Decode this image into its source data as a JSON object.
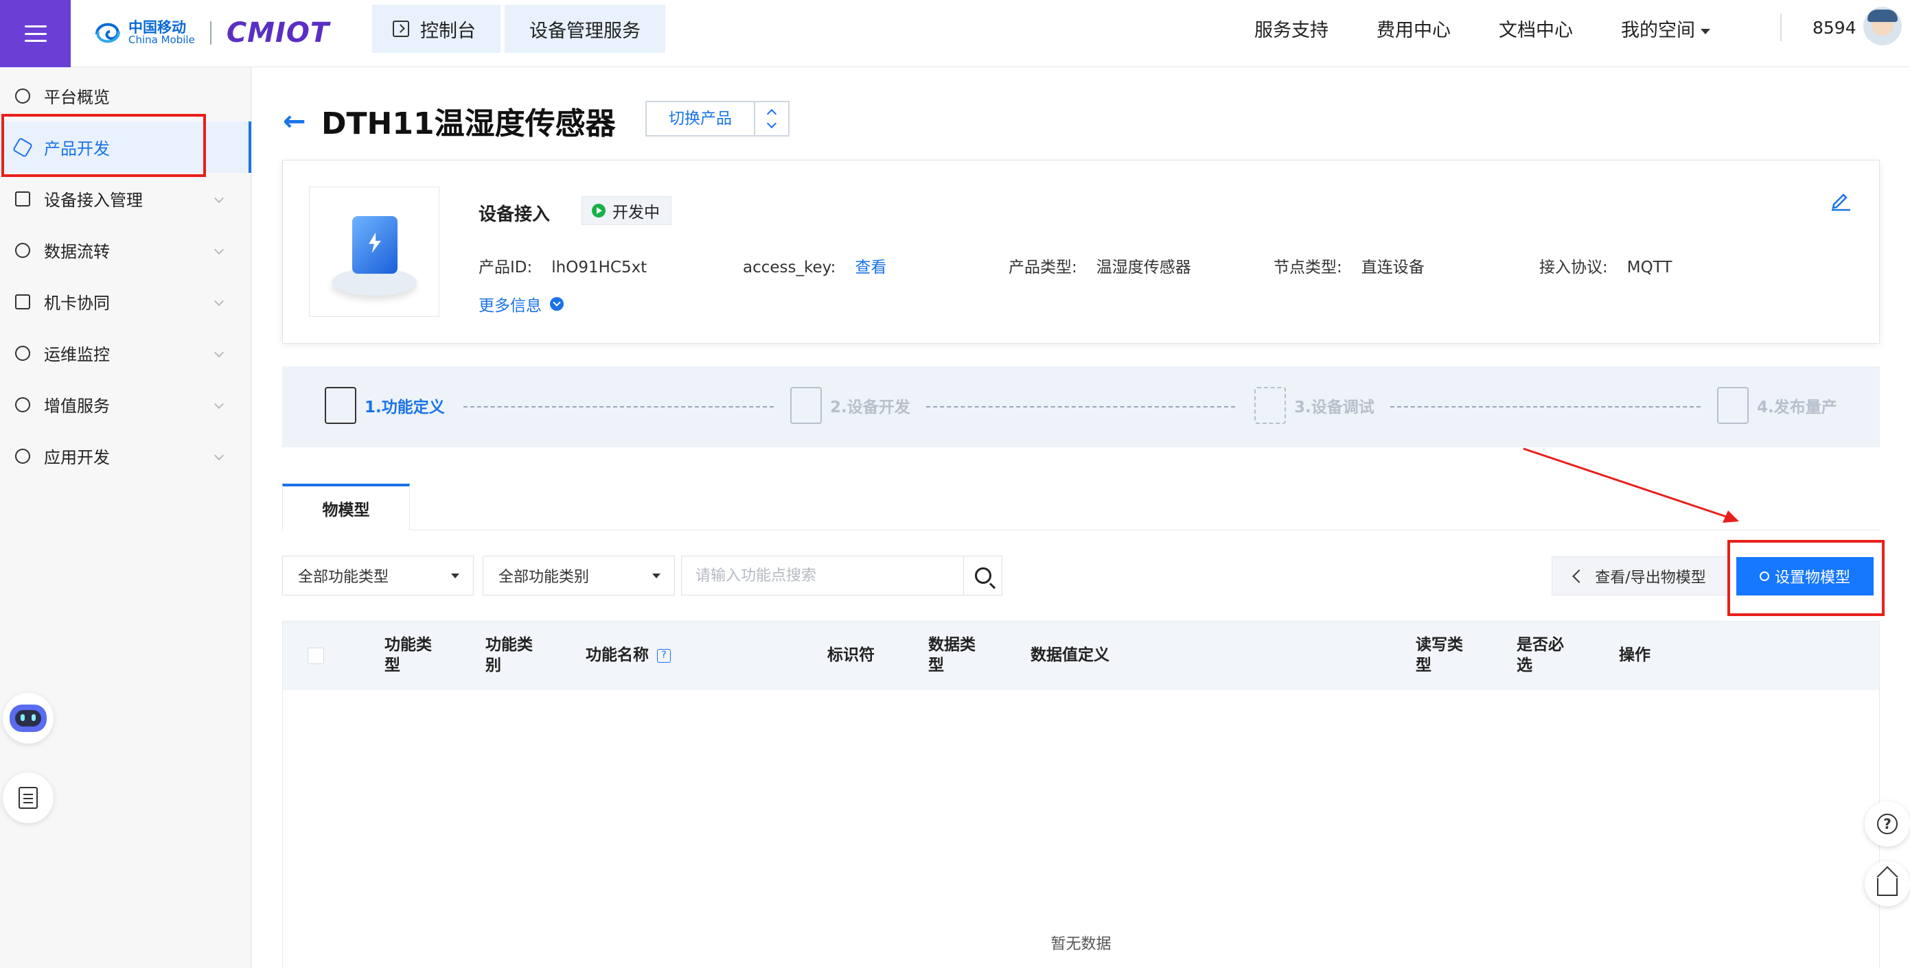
{
  "header": {
    "logo_cn": "中国移动",
    "logo_en": "China Mobile",
    "logo_product": "CMIOT",
    "breadcrumbs": [
      "控制台",
      "设备管理服务"
    ],
    "nav": [
      "服务支持",
      "费用中心",
      "文档中心",
      "我的空间"
    ],
    "user_id": "8594"
  },
  "sidebar": {
    "items": [
      {
        "label": "平台概览",
        "icon": "overview-icon"
      },
      {
        "label": "产品开发",
        "icon": "cube-icon",
        "active": true
      },
      {
        "label": "设备接入管理",
        "icon": "device-icon"
      },
      {
        "label": "数据流转",
        "icon": "flow-icon"
      },
      {
        "label": "机卡协同",
        "icon": "card-icon"
      },
      {
        "label": "运维监控",
        "icon": "monitor-icon"
      },
      {
        "label": "增值服务",
        "icon": "rocket-icon"
      },
      {
        "label": "应用开发",
        "icon": "app-icon"
      }
    ]
  },
  "product": {
    "title": "DTH11温湿度传感器",
    "switch_label": "切换产品",
    "access_type": "设备接入",
    "status": "开发中",
    "id_label": "产品ID:",
    "id_value": "lhO91HC5xt",
    "key_label": "access_key:",
    "key_value": "查看",
    "type_label": "产品类型:",
    "type_value": "温湿度传感器",
    "node_label": "节点类型:",
    "node_value": "直连设备",
    "protocol_label": "接入协议:",
    "protocol_value": "MQTT",
    "more_label": "更多信息"
  },
  "steps": [
    "1.功能定义",
    "2.设备开发",
    "3.设备调试",
    "4.发布量产"
  ],
  "tabs": [
    "物模型"
  ],
  "filters": {
    "type_select": "全部功能类型",
    "category_select": "全部功能类别",
    "search_placeholder": "请输入功能点搜索",
    "view_export_label": "查看/导出物模型",
    "setup_label": "设置物模型"
  },
  "table": {
    "headers": [
      "功能类\n型",
      "功能类\n别",
      "功能名称",
      "标识符",
      "数据类\n型",
      "数据值定义",
      "读写类\n型",
      "是否必\n选",
      "操作"
    ],
    "empty_text": "暂无数据"
  },
  "colors": {
    "accent": "#1677ff",
    "brand_purple": "#6b3fd6",
    "highlight_red": "#e8201b",
    "status_green": "#19b04a"
  }
}
